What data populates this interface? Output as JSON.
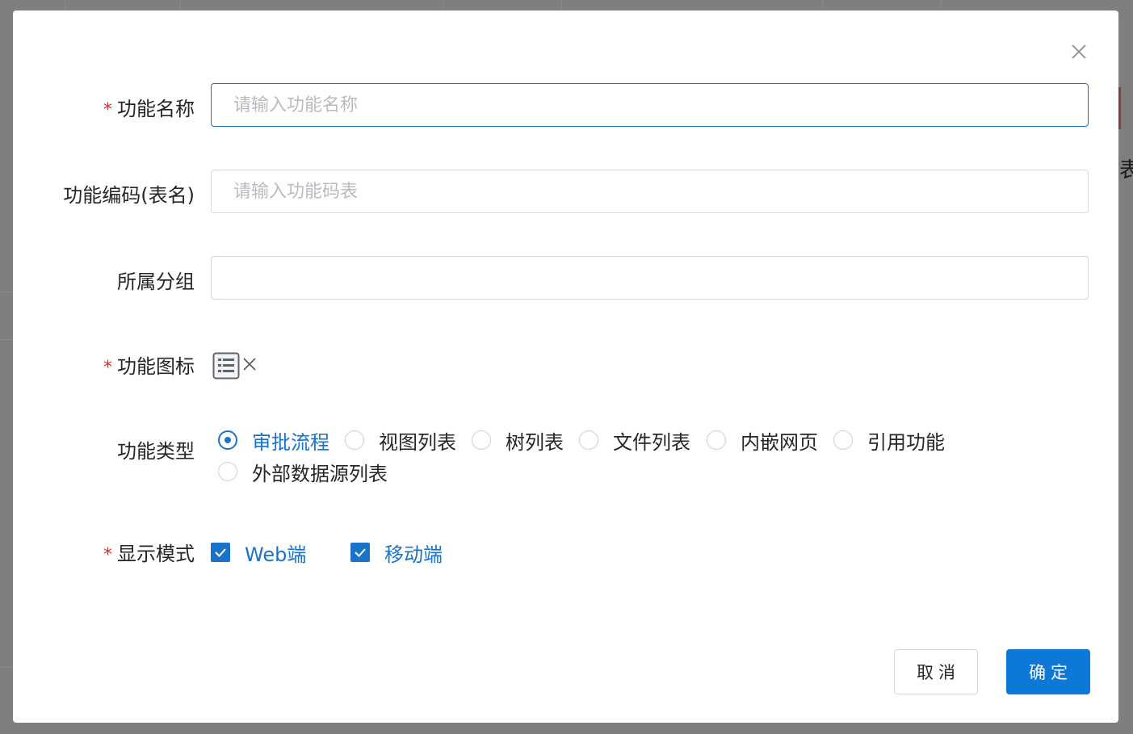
{
  "background": {
    "side_text": "表"
  },
  "dialog": {
    "fields": {
      "name": {
        "label": "功能名称",
        "required": "*",
        "placeholder": "请输入功能名称",
        "value": ""
      },
      "code": {
        "label": "功能编码(表名)",
        "placeholder": "请输入功能码表",
        "value": ""
      },
      "group": {
        "label": "所属分组",
        "value": ""
      },
      "icon": {
        "label": "功能图标",
        "required": "*",
        "icon_name": "list-icon"
      },
      "type": {
        "label": "功能类型",
        "options": [
          {
            "label": "审批流程",
            "checked": true
          },
          {
            "label": "视图列表",
            "checked": false
          },
          {
            "label": "树列表",
            "checked": false
          },
          {
            "label": "文件列表",
            "checked": false
          },
          {
            "label": "内嵌网页",
            "checked": false
          },
          {
            "label": "引用功能",
            "checked": false
          },
          {
            "label": "外部数据源列表",
            "checked": false
          }
        ]
      },
      "display_mode": {
        "label": "显示模式",
        "required": "*",
        "options": [
          {
            "label": "Web端",
            "checked": true
          },
          {
            "label": "移动端",
            "checked": true
          }
        ]
      }
    },
    "buttons": {
      "cancel": "取消",
      "ok": "确定"
    },
    "colors": {
      "primary": "#1a73c8",
      "required": "#f5222d",
      "ok_button": "#0e78d8"
    }
  }
}
